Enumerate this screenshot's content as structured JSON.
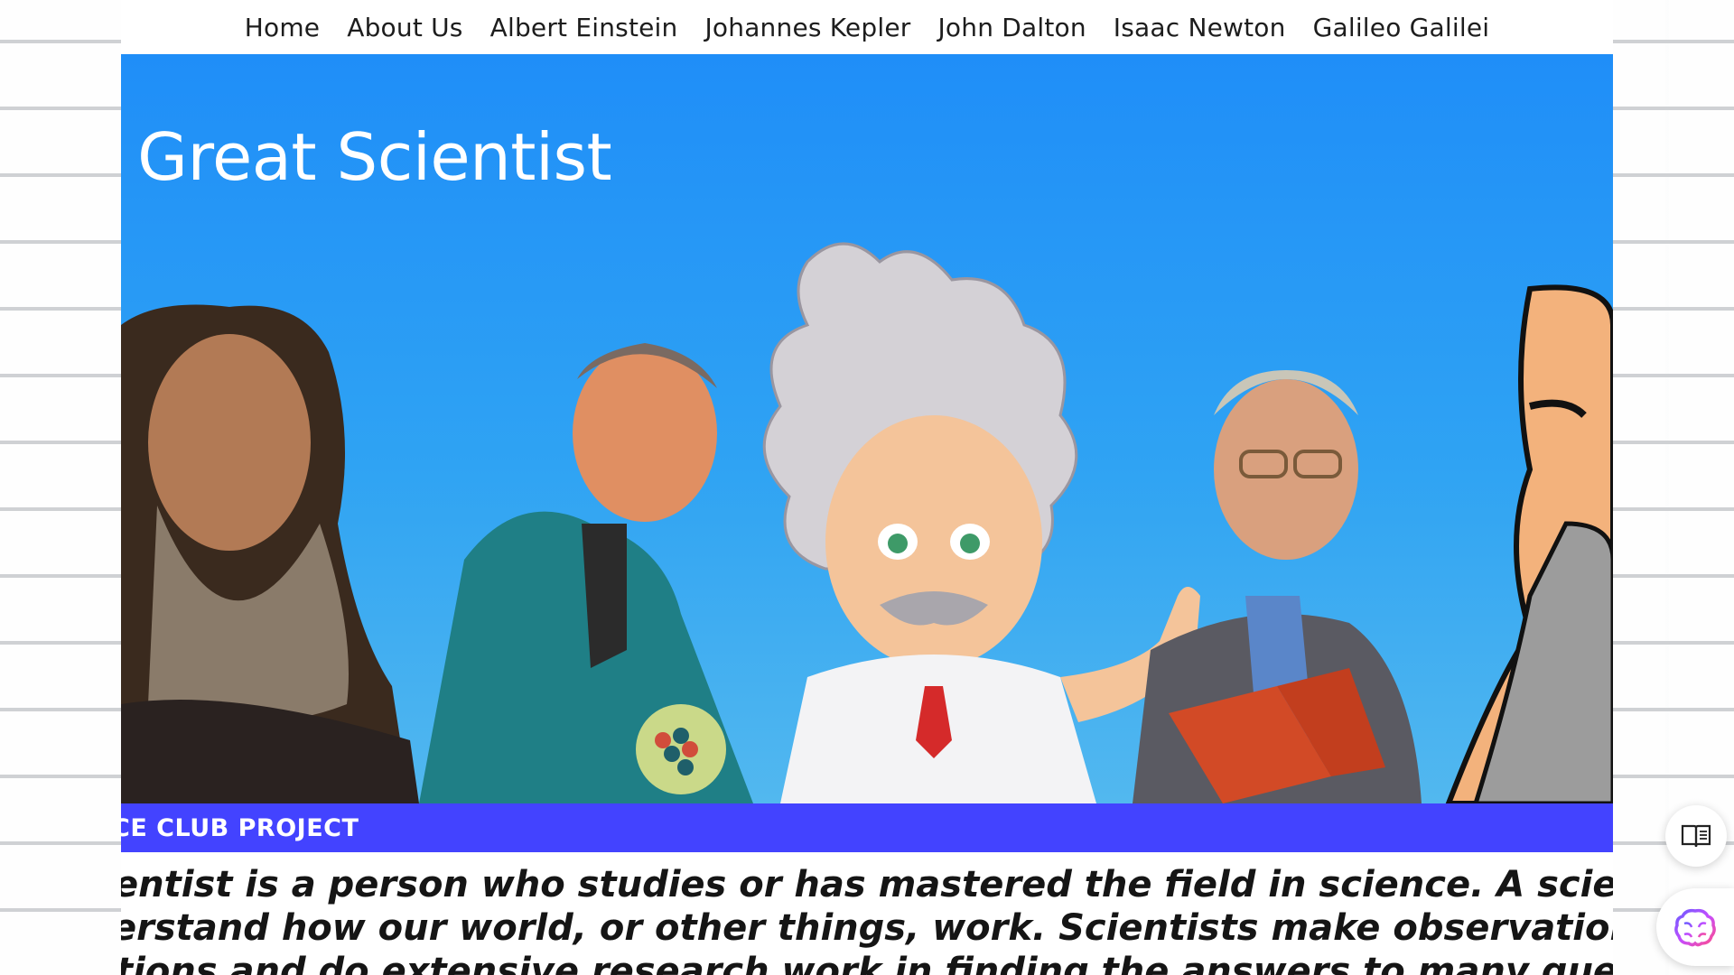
{
  "nav": {
    "items": [
      {
        "label": "Home"
      },
      {
        "label": "About Us"
      },
      {
        "label": "Albert Einstein"
      },
      {
        "label": "Johannes Kepler"
      },
      {
        "label": "John Dalton"
      },
      {
        "label": "Isaac Newton"
      },
      {
        "label": "Galileo Galilei"
      }
    ]
  },
  "hero": {
    "title": "e Great Scientist"
  },
  "banner": {
    "text": "CE CLUB PROJECT"
  },
  "intro": {
    "lines": [
      "entist is a person who studies or has mastered the field in science. A scientist tr",
      "erstand how our world, or other things, work. Scientists make observations",
      "tions and do extensive research work in finding the answers to many que"
    ]
  },
  "floating": {
    "reader_icon": "open-book-icon",
    "assistant_icon": "brain-icon"
  },
  "colors": {
    "hero_blue": "#1f8ef8",
    "banner_blue": "#4343ff",
    "nav_text": "#1d1d1d"
  }
}
